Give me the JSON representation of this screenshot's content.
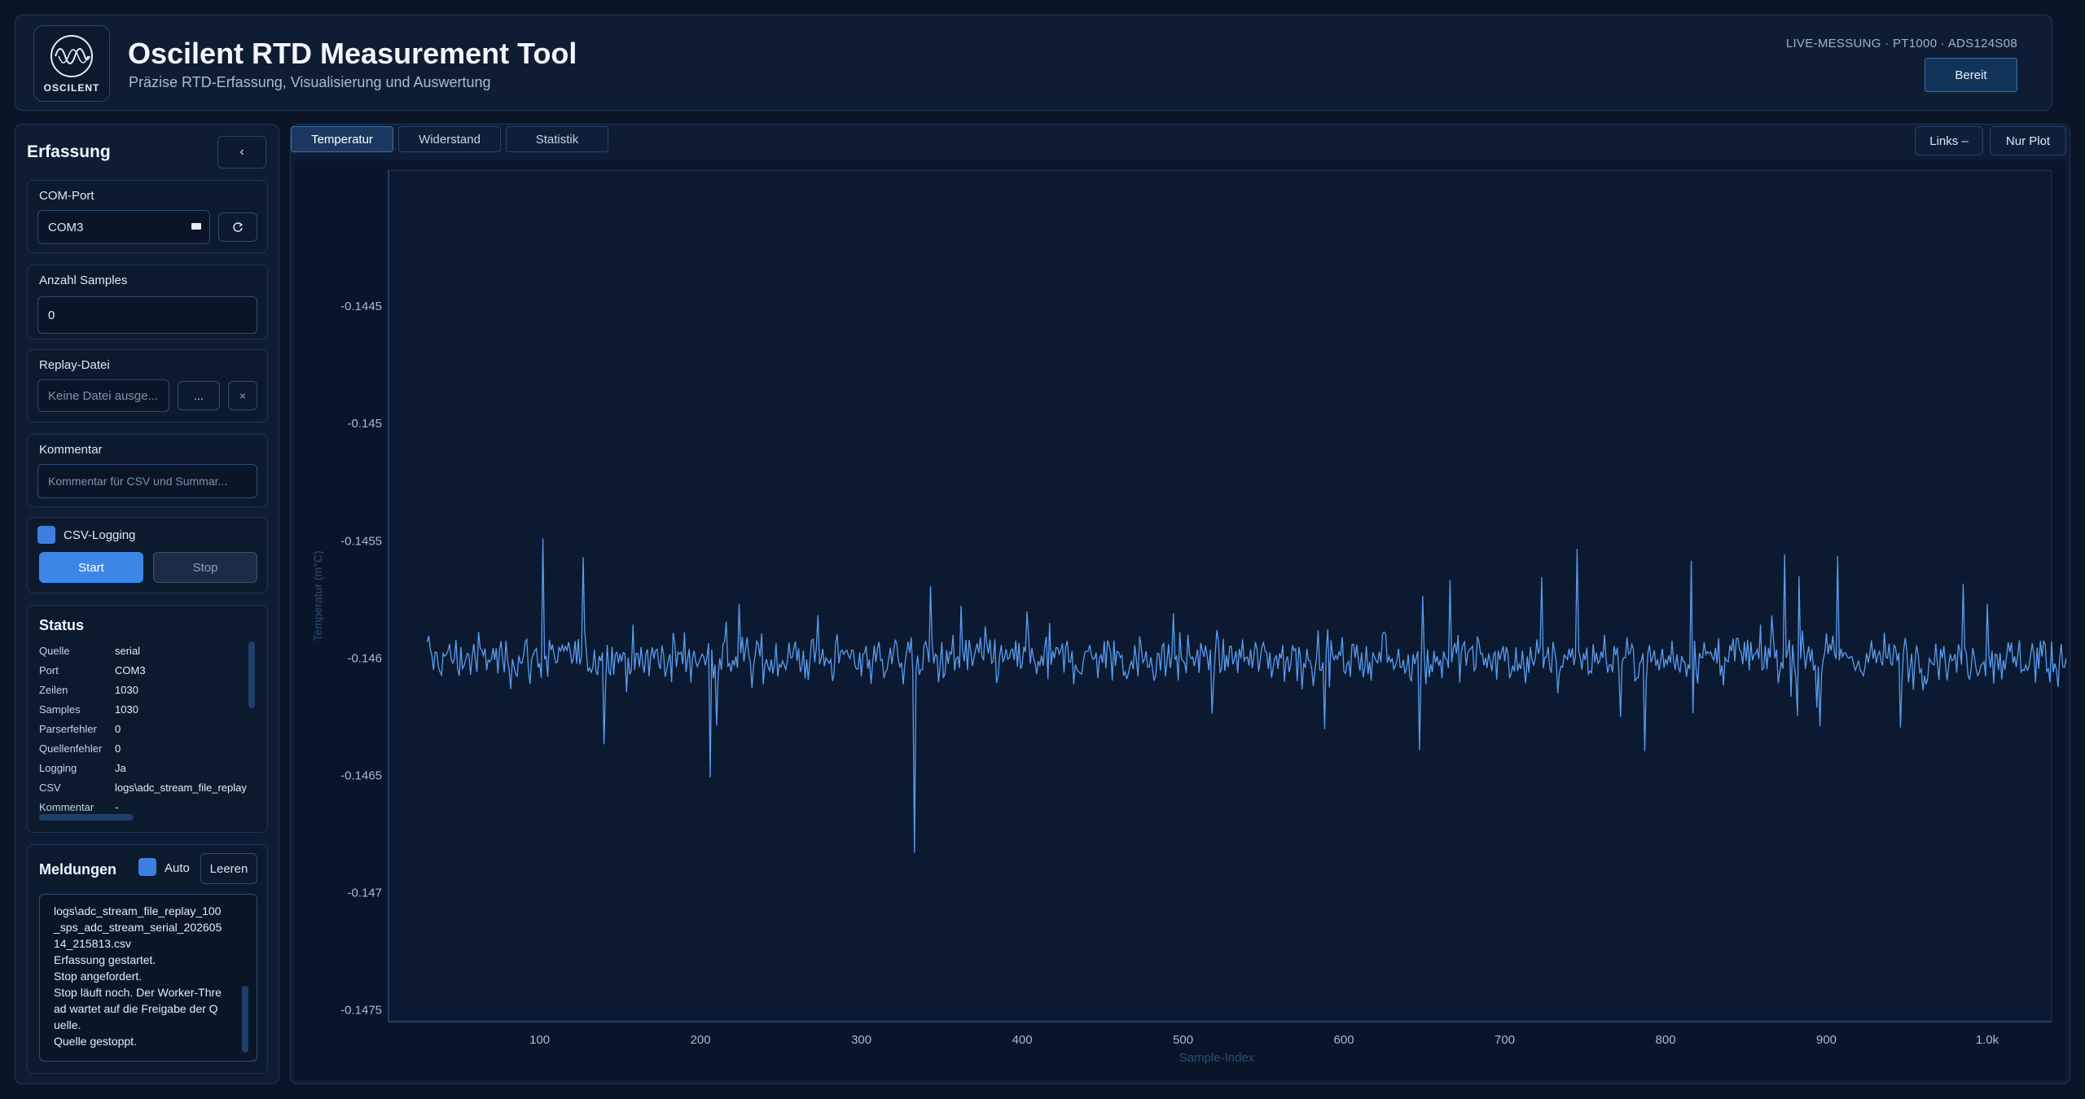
{
  "header": {
    "logo_text": "OSCILENT",
    "title": "Oscilent RTD Measurement Tool",
    "subtitle": "Präzise RTD-Erfassung, Visualisierung und Auswertung",
    "live_info": "LIVE-MESSUNG · PT1000 · ADS124S08",
    "status_button": "Bereit"
  },
  "sidebar": {
    "title": "Erfassung",
    "collapse_label": "‹",
    "com_port": {
      "label": "COM-Port",
      "value": "COM3",
      "refresh_icon": "refresh-icon"
    },
    "samples": {
      "label": "Anzahl Samples",
      "value": "0"
    },
    "replay": {
      "label": "Replay-Datei",
      "placeholder": "Keine Datei ausge...",
      "browse_label": "...",
      "clear_label": "×"
    },
    "comment": {
      "label": "Kommentar",
      "placeholder": "Kommentar für CSV und Summar..."
    },
    "csv_logging": {
      "label": "CSV-Logging",
      "checked": true
    },
    "start_label": "Start",
    "stop_label": "Stop",
    "status": {
      "title": "Status",
      "rows": [
        {
          "key": "Quelle",
          "value": "serial"
        },
        {
          "key": "Port",
          "value": "COM3"
        },
        {
          "key": "Zeilen",
          "value": "1030"
        },
        {
          "key": "Samples",
          "value": "1030"
        },
        {
          "key": "Parserfehler",
          "value": "0"
        },
        {
          "key": "Quellenfehler",
          "value": "0"
        },
        {
          "key": "Logging",
          "value": "Ja"
        },
        {
          "key": "CSV",
          "value": "logs\\adc_stream_file_replay"
        },
        {
          "key": "Kommentar",
          "value": "-"
        }
      ]
    },
    "messages": {
      "title": "Meldungen",
      "auto_label": "Auto",
      "clear_label": "Leeren",
      "lines": [
        "logs\\adc_stream_file_replay_100_sps_adc_stream_serial_20260514_215813.csv",
        "Erfassung gestartet.",
        "Stop angefordert.",
        "Stop läuft noch. Der Worker-Thread wartet auf die Freigabe der Quelle.",
        "Quelle gestoppt."
      ]
    }
  },
  "tabs": [
    {
      "label": "Temperatur",
      "active": true
    },
    {
      "label": "Widerstand",
      "active": false
    },
    {
      "label": "Statistik",
      "active": false
    }
  ],
  "toolbar": {
    "left_label": "Links –",
    "plot_only_label": "Nur Plot"
  },
  "chart_data": {
    "type": "line",
    "xlabel": "Sample-Index",
    "ylabel": "Temperatur (m°C)",
    "xlim": [
      6,
      1040
    ],
    "ylim": [
      -0.14755,
      -0.14392
    ],
    "x_ticks": [
      100,
      200,
      300,
      400,
      500,
      600,
      700,
      800,
      900,
      1000
    ],
    "x_tick_labels": [
      "100",
      "200",
      "300",
      "400",
      "500",
      "600",
      "700",
      "800",
      "900",
      "1.0k"
    ],
    "y_ticks": [
      -0.1445,
      -0.145,
      -0.1455,
      -0.146,
      -0.1465,
      -0.147,
      -0.1475
    ],
    "y_tick_labels": [
      "-0.1445",
      "-0.145",
      "-0.1455",
      "-0.146",
      "-0.1465",
      "-0.147",
      "-0.1475"
    ],
    "series": [
      {
        "color": "#5b9cf0",
        "x_start": 30,
        "x_step": 1,
        "count": 1030,
        "values_note_approx": [
          -0.146,
          -0.1459,
          -0.14605,
          -0.14585,
          -0.146
        ],
        "mean": -0.146,
        "noise_band": [
          -0.1462,
          -0.1458
        ],
        "max": -0.14549,
        "min": -0.14683,
        "max_at": 102,
        "min_at": 333
      }
    ],
    "grid": false,
    "legend": "none"
  }
}
